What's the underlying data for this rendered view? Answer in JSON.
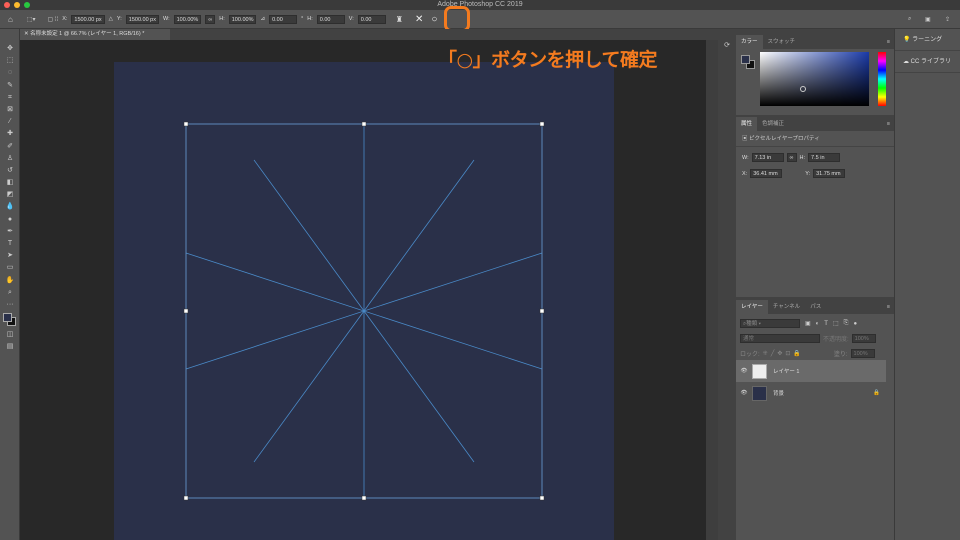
{
  "app": {
    "title": "Adobe Photoshop CC 2019"
  },
  "options": {
    "x_label": "X:",
    "x": "1500.00 px",
    "y_label": "Y:",
    "y": "1500.00 px",
    "w_label": "W:",
    "w": "100.00%",
    "h_label": "H:",
    "h": "100.00%",
    "angle": "0.00",
    "deg": "°",
    "hskew_label": "H:",
    "hskew": "0.00",
    "vskew_label": "V:",
    "vskew": "0.00",
    "cancel": "✕",
    "commit": "○"
  },
  "document": {
    "tab": "名称未設定 1 @ 66.7% (レイヤー 1, RGB/16) *",
    "bg_color": "#2a3049",
    "line_color": "#4a8ac8"
  },
  "color_panel": {
    "tabs": [
      "カラー",
      "スウォッチ"
    ],
    "fg": "#2a3049",
    "bg": "#111111"
  },
  "properties": {
    "tabs": [
      "属性",
      "色調補正"
    ],
    "type": "ピクセルレイヤープロパティ",
    "w_label": "W:",
    "w": "7.13 in",
    "h_label": "H:",
    "h": "7.5 in",
    "x_label": "X:",
    "x": "36.41 mm",
    "y_label": "Y:",
    "y": "31.75 mm"
  },
  "layers_panel": {
    "tabs": [
      "レイヤー",
      "チャンネル",
      "パス"
    ],
    "filter": "種類",
    "blend": "通常",
    "opacity_label": "不透明度:",
    "opacity": "100%",
    "lock_label": "ロック:",
    "fill_label": "塗り:",
    "fill": "100%",
    "layers": [
      {
        "name": "レイヤー 1",
        "selected": true
      },
      {
        "name": "背景",
        "selected": false
      }
    ]
  },
  "right": {
    "learn": "ラーニング",
    "cc": "CC ライブラリ"
  },
  "annotation": "「○」ボタンを押して確定",
  "accent": "#f47b1f"
}
